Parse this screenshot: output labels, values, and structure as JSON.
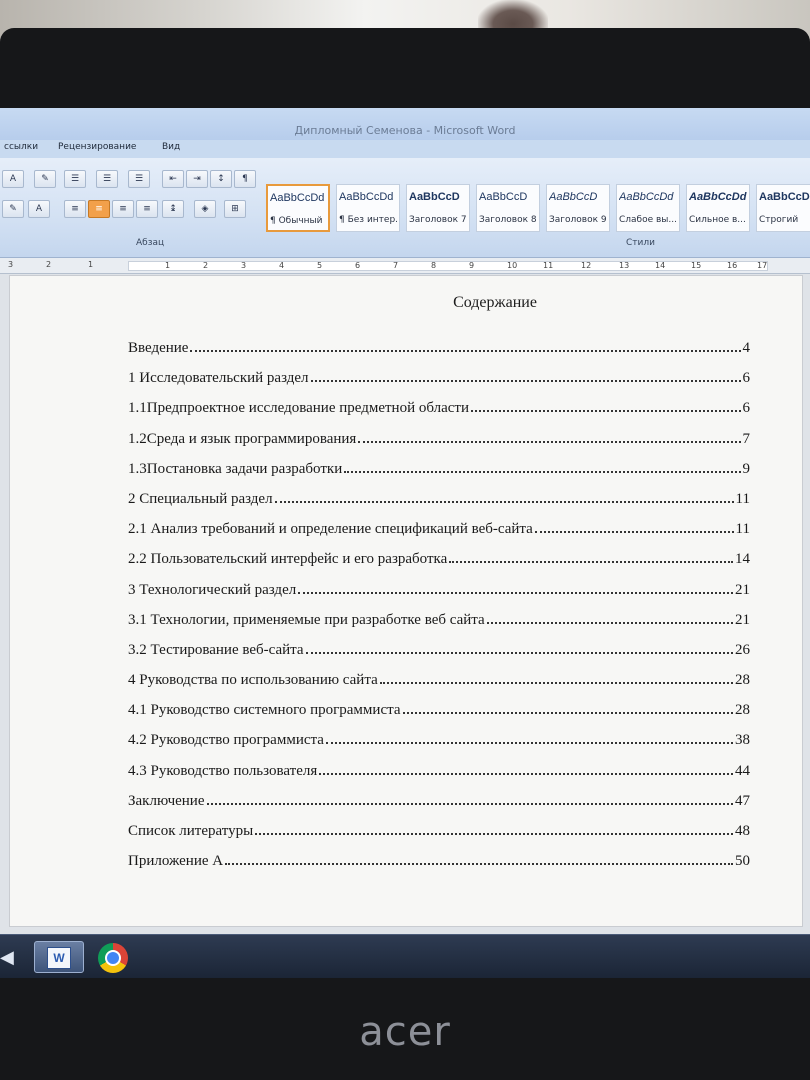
{
  "window": {
    "title": "Дипломный Семенова - Microsoft Word"
  },
  "ribbon_tabs": [
    "ссылки",
    "Рецензирование",
    "Вид"
  ],
  "ribbon_groups": {
    "paragraph_label": "Абзац",
    "styles_label": "Стили"
  },
  "styles": [
    {
      "sample": "AaBbCcDd",
      "name": "¶ Обычный",
      "selected": true
    },
    {
      "sample": "AaBbCcDd",
      "name": "¶ Без интер...",
      "selected": false
    },
    {
      "sample": "AaBbCcD",
      "name": "Заголовок 7",
      "selected": false
    },
    {
      "sample": "AaBbCcD",
      "name": "Заголовок 8",
      "selected": false
    },
    {
      "sample": "AaBbCcD",
      "name": "Заголовок 9",
      "selected": false
    },
    {
      "sample": "AaBbCcDd",
      "name": "Слабое вы...",
      "selected": false
    },
    {
      "sample": "AaBbCcDd",
      "name": "Сильное в...",
      "selected": false
    },
    {
      "sample": "AaBbCcDd",
      "name": "Строгий",
      "selected": false
    }
  ],
  "ruler_ticks": [
    "3",
    "2",
    "1",
    "1",
    "2",
    "3",
    "4",
    "5",
    "6",
    "7",
    "8",
    "9",
    "10",
    "11",
    "12",
    "13",
    "14",
    "15",
    "16",
    "17"
  ],
  "document": {
    "heading": "Содержание",
    "toc": [
      {
        "label": "Введение",
        "page": "4"
      },
      {
        "label": "1 Исследовательский раздел",
        "page": "6"
      },
      {
        "label": "1.1Предпроектное исследование предметной области",
        "page": "6"
      },
      {
        "label": "1.2Среда и язык программирования",
        "page": "7"
      },
      {
        "label": "1.3Постановка задачи разработки",
        "page": "9"
      },
      {
        "label": "2 Специальный раздел",
        "page": "11"
      },
      {
        "label": "2.1 Анализ требований и определение спецификаций веб-сайта",
        "page": "11"
      },
      {
        "label": "2.2 Пользовательский интерфейс и его разработка",
        "page": "14"
      },
      {
        "label": "3 Технологический раздел",
        "page": "21"
      },
      {
        "label": "3.1 Технологии, применяемые при разработке веб сайта",
        "page": "21"
      },
      {
        "label": "3.2 Тестирование веб-сайта",
        "page": "26"
      },
      {
        "label": "4 Руководства по использованию сайта",
        "page": "28"
      },
      {
        "label": "4.1 Руководство системного программиста",
        "page": "28"
      },
      {
        "label": "4.2 Руководство программиста",
        "page": "38"
      },
      {
        "label": "4.3 Руководство пользователя",
        "page": "44"
      },
      {
        "label": "Заключение",
        "page": "47"
      },
      {
        "label": "Список литературы",
        "page": "48"
      },
      {
        "label": "Приложение А",
        "page": "50"
      }
    ]
  },
  "laptop_brand": "acer"
}
